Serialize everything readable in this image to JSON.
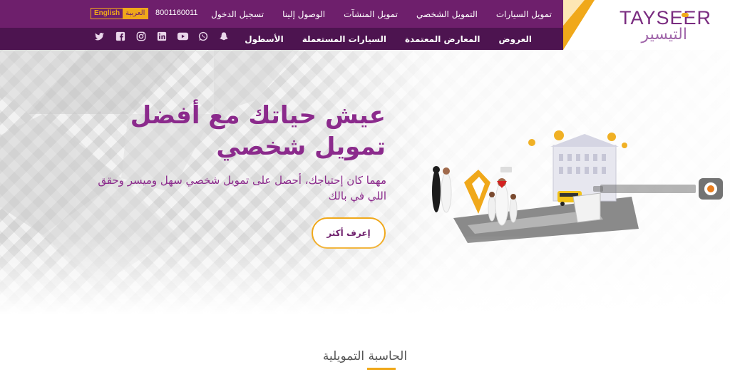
{
  "brand": {
    "name_en": "TAYSEER",
    "name_ar": "التيسير"
  },
  "top_nav": {
    "items": [
      "تمويل السيارات",
      "التمويل الشخصي",
      "تمويل المنشآت",
      "الوصول إلينا",
      "تسجيل الدخول"
    ],
    "phone": "8001160011",
    "lang_ar": "العربية",
    "lang_en": "English"
  },
  "sub_nav": {
    "items": [
      "العروض",
      "المعارض المعتمدة",
      "السيارات المستعملة",
      "الأسطول"
    ]
  },
  "social_icons": [
    "snapchat-icon",
    "whatsapp-icon",
    "youtube-icon",
    "linkedin-icon",
    "instagram-icon",
    "facebook-icon",
    "twitter-icon"
  ],
  "hero": {
    "title_line1": "عيش حياتك مع أفضل",
    "title_line2": "تمويل شخصي",
    "subtitle_line1": "مهما كان إحتياجك، أحصل على تمويل شخصي سهل وميسر وحقق",
    "subtitle_line2": "اللي في بالك",
    "cta": "إعرف أكثر"
  },
  "section": {
    "calculator_title": "الحاسبة التمويلية"
  },
  "colors": {
    "primary": "#6e1f6c",
    "primary_dark": "#4d1450",
    "accent": "#f0a81a",
    "hero_text": "#8b2a8c"
  }
}
